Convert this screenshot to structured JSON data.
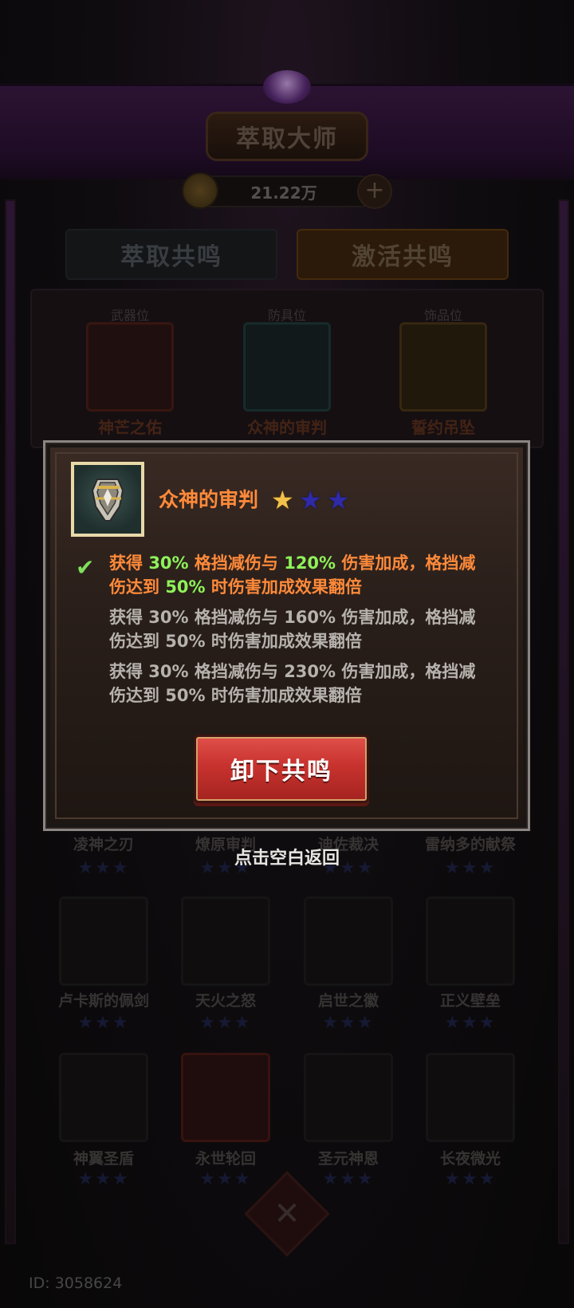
{
  "header": {
    "title": "萃取大师",
    "currency_amount": "21.22万",
    "plus_symbol": "+"
  },
  "tabs": [
    {
      "label": "萃取共鸣",
      "active": false
    },
    {
      "label": "激活共鸣",
      "active": true
    }
  ],
  "equip_slots": [
    {
      "slot_label": "武器位",
      "item_name": "神芒之佑"
    },
    {
      "slot_label": "防具位",
      "item_name": "众神的审判"
    },
    {
      "slot_label": "饰品位",
      "item_name": "誓约吊坠"
    }
  ],
  "grid": {
    "row1": [
      {
        "name": "凌神之刃"
      },
      {
        "name": "燎原审判"
      },
      {
        "name": "迪佐裁决"
      },
      {
        "name": "雷纳多的献祭"
      }
    ],
    "row2": [
      {
        "name": "卢卡斯的佩剑"
      },
      {
        "name": "天火之怒"
      },
      {
        "name": "启世之徽"
      },
      {
        "name": "正义壁垒"
      }
    ],
    "row3": [
      {
        "name": "神翼圣盾"
      },
      {
        "name": "永世轮回"
      },
      {
        "name": "圣元神恩"
      },
      {
        "name": "长夜微光"
      }
    ],
    "star_glyph": "★★★"
  },
  "modal": {
    "item_name": "众神的审判",
    "stars_filled": 1,
    "stars_total": 3,
    "star_glyph": "★",
    "check_glyph": "✔",
    "tiers": [
      {
        "active": true,
        "p1": "获得 ",
        "v1": "30%",
        "p2": " 格挡减伤与 ",
        "v2": "120%",
        "p3": " 伤害加成，格挡减伤达到 ",
        "v3": "50%",
        "p4": " 时伤害加成效果翻倍"
      },
      {
        "active": false,
        "text": "获得 30% 格挡减伤与 160% 伤害加成，格挡减伤达到 50% 时伤害加成效果翻倍"
      },
      {
        "active": false,
        "text": "获得 30% 格挡减伤与 230% 伤害加成，格挡减伤达到 50% 时伤害加成效果翻倍"
      }
    ],
    "button_label": "卸下共鸣"
  },
  "dismiss_hint": "点击空白返回",
  "footer": {
    "player_id": "ID: 3058624",
    "emblem_glyph": "✕"
  },
  "colors": {
    "accent_orange": "#ff8a3a",
    "highlight_green": "#8ef25a",
    "button_red": "#c8322e",
    "star_gold": "#f2c14a",
    "star_empty": "#2e2aa8"
  }
}
